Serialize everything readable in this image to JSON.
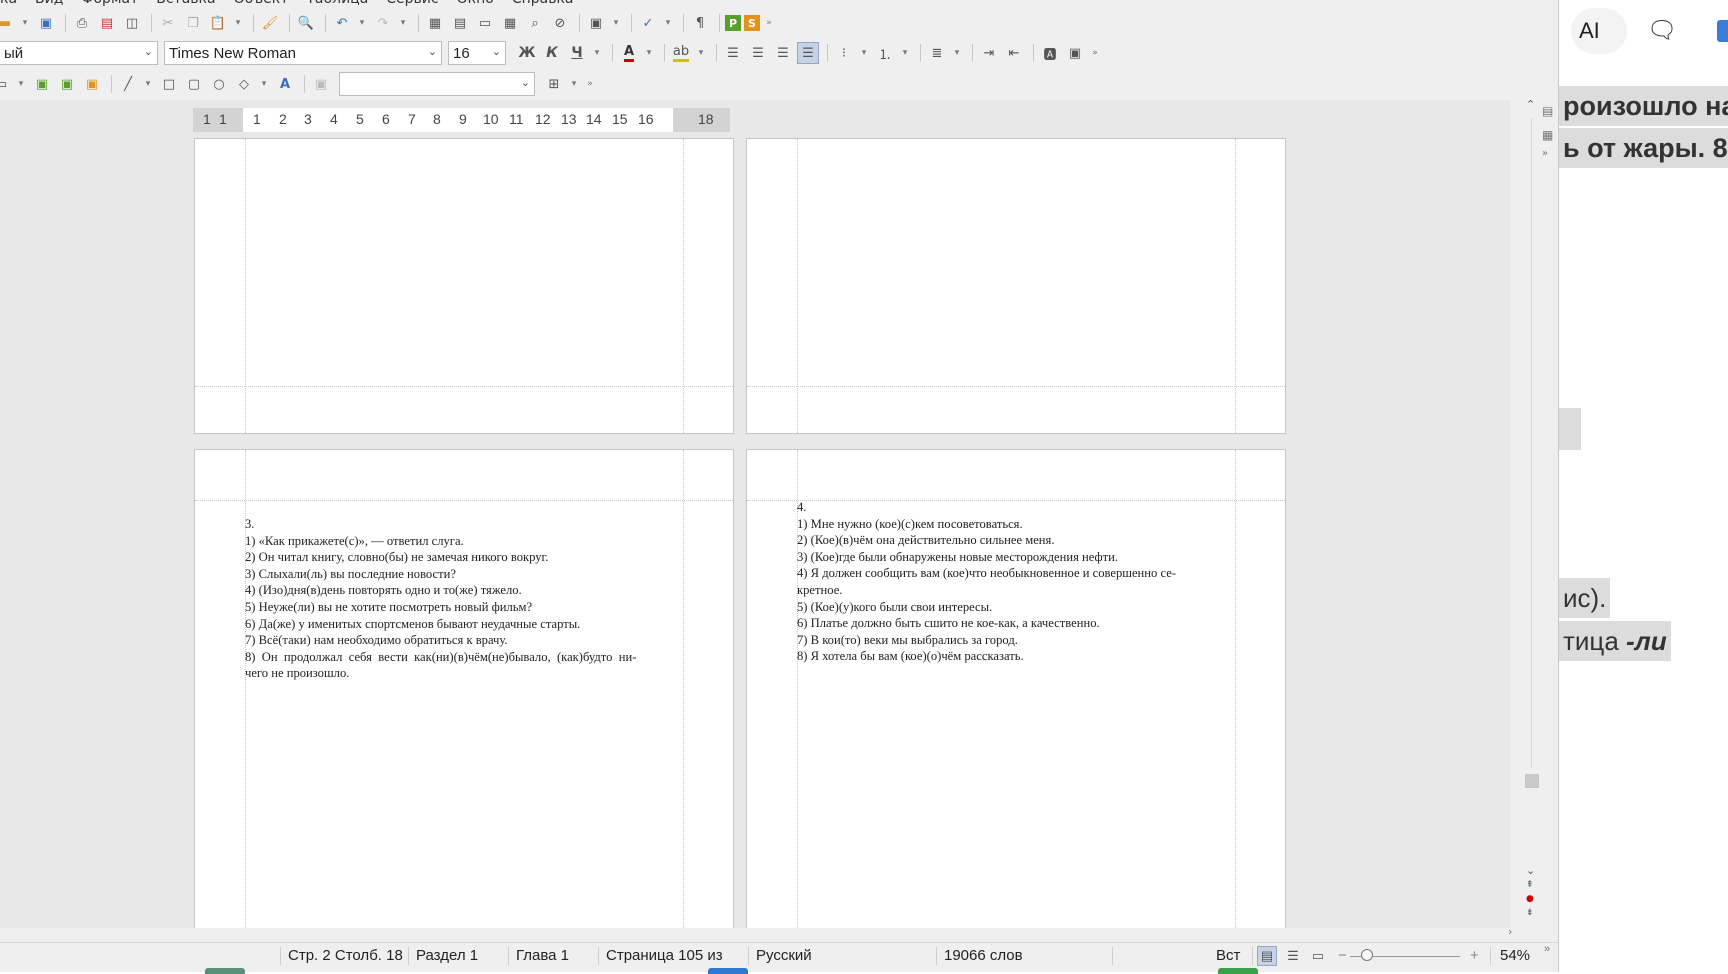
{
  "menu": {
    "items": [
      "ка",
      "Вид",
      "Формат",
      "Вставка",
      "Объект",
      "Таблица",
      "Сервис",
      "Окно",
      "Справка"
    ]
  },
  "toolbar": {
    "style_value": "ый",
    "font_name": "Times New Roman",
    "font_size": "16",
    "bold_label": "Ж",
    "italic_label": "К",
    "underline_label": "Ч",
    "pilcrow": "¶",
    "more": "»"
  },
  "ruler": {
    "ticks": [
      "1",
      "1",
      "1",
      "2",
      "3",
      "4",
      "5",
      "6",
      "7",
      "8",
      "9",
      "10",
      "11",
      "12",
      "13",
      "14",
      "15",
      "16",
      "18"
    ]
  },
  "pages": {
    "page3": {
      "heading": "3.",
      "lines": [
        "1) «Как прикажете(с)», — ответил слуга.",
        "2) Он читал книгу, словно(бы) не замечая никого вокруг.",
        "3) Слыхали(ль) вы последние новости?",
        "4) (Изо)дня(в)день повторять одно и то(же) тяжело.",
        "5) Неуже(ли) вы не хотите посмотреть новый фильм?",
        "6) Да(же) у именитых спортсменов бывают неудачные старты.",
        "7) Всё(таки) нам необходимо обратиться к врачу.",
        "8)  Он  продолжал  себя  вести  как(ни)(в)чём(не)бывало,  (как)будто  ни-",
        "чего не произошло."
      ]
    },
    "page4": {
      "heading": "4.",
      "lines": [
        "1) Мне нужно (кое)(с)кем посоветоваться.",
        "2) (Кое)(в)чём она действительно сильнее меня.",
        "3) (Кое)где были обнаружены новые месторождения нефти.",
        "4) Я должен сообщить вам (кое)что необыкновенное и совершенно се-",
        "кретное.",
        "5) (Кое)(у)кого были свои интересы.",
        "6) Платье должно быть сшито не кое-как, а качественно.",
        "7) В кои(то) веки мы выбрались за город.",
        "8) Я хотела бы вам (кое)(о)чём рассказать."
      ]
    }
  },
  "statusbar": {
    "position": "Стр. 2 Столб. 18",
    "section": "Раздел 1",
    "chapter": "Глава 1",
    "page": "Страница 105 из",
    "language": "Русский",
    "words": "19066 слов",
    "insert_mode": "Вст",
    "zoom_minus": "−",
    "zoom_plus": "+",
    "zoom": "54%",
    "more": "»"
  },
  "right_panel": {
    "ai_label": "AI",
    "snippet1": "роизошло на",
    "snippet2": "ь от жары. 8)",
    "snippet3": "ис).",
    "snippet4_text": "тица ",
    "snippet4_em": "-ли"
  },
  "icons": [
    "open-icon",
    "save-icon",
    "print-icon",
    "pdf-icon",
    "preview-icon",
    "cut-icon",
    "copy-icon",
    "paste-icon",
    "clone-format-icon",
    "find-icon",
    "undo-icon",
    "redo-icon",
    "table-icon",
    "spellcheck-icon",
    "pilcrow-icon"
  ]
}
